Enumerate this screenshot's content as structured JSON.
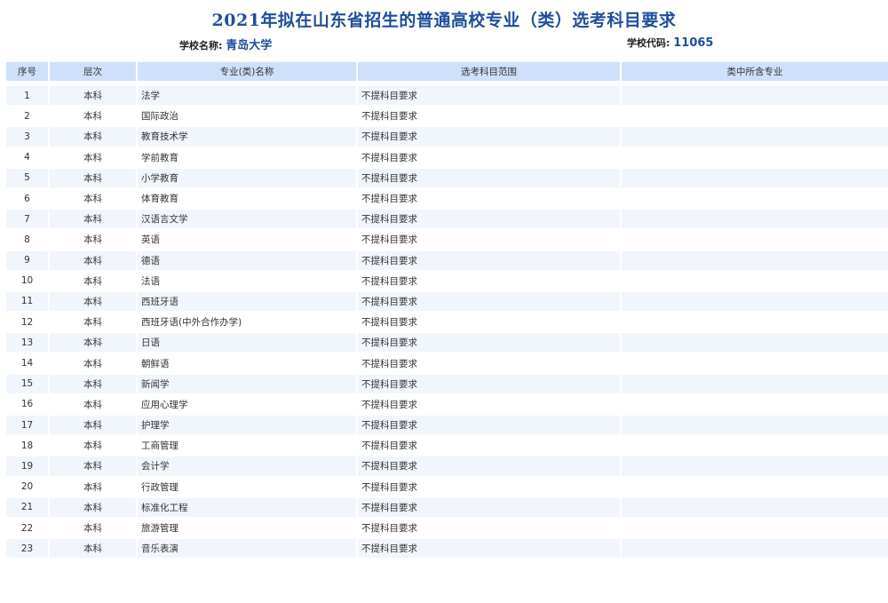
{
  "title": "2021年拟在山东省招生的普通高校专业（类）选考科目要求",
  "school": {
    "name_label": "学校名称:",
    "name": "青岛大学",
    "code_label": "学校代码:",
    "code": "11065"
  },
  "columns": [
    "序号",
    "层次",
    "专业(类)名称",
    "选考科目范围",
    "类中所含专业"
  ],
  "rows": [
    {
      "no": "1",
      "level": "本科",
      "major": "法学",
      "req": "不提科目要求",
      "sub": ""
    },
    {
      "no": "2",
      "level": "本科",
      "major": "国际政治",
      "req": "不提科目要求",
      "sub": ""
    },
    {
      "no": "3",
      "level": "本科",
      "major": "教育技术学",
      "req": "不提科目要求",
      "sub": ""
    },
    {
      "no": "4",
      "level": "本科",
      "major": "学前教育",
      "req": "不提科目要求",
      "sub": ""
    },
    {
      "no": "5",
      "level": "本科",
      "major": "小学教育",
      "req": "不提科目要求",
      "sub": ""
    },
    {
      "no": "6",
      "level": "本科",
      "major": "体育教育",
      "req": "不提科目要求",
      "sub": ""
    },
    {
      "no": "7",
      "level": "本科",
      "major": "汉语言文学",
      "req": "不提科目要求",
      "sub": ""
    },
    {
      "no": "8",
      "level": "本科",
      "major": "英语",
      "req": "不提科目要求",
      "sub": ""
    },
    {
      "no": "9",
      "level": "本科",
      "major": "德语",
      "req": "不提科目要求",
      "sub": ""
    },
    {
      "no": "10",
      "level": "本科",
      "major": "法语",
      "req": "不提科目要求",
      "sub": ""
    },
    {
      "no": "11",
      "level": "本科",
      "major": "西班牙语",
      "req": "不提科目要求",
      "sub": ""
    },
    {
      "no": "12",
      "level": "本科",
      "major": "西班牙语(中外合作办学)",
      "req": "不提科目要求",
      "sub": ""
    },
    {
      "no": "13",
      "level": "本科",
      "major": "日语",
      "req": "不提科目要求",
      "sub": ""
    },
    {
      "no": "14",
      "level": "本科",
      "major": "朝鲜语",
      "req": "不提科目要求",
      "sub": ""
    },
    {
      "no": "15",
      "level": "本科",
      "major": "新闻学",
      "req": "不提科目要求",
      "sub": ""
    },
    {
      "no": "16",
      "level": "本科",
      "major": "应用心理学",
      "req": "不提科目要求",
      "sub": ""
    },
    {
      "no": "17",
      "level": "本科",
      "major": "护理学",
      "req": "不提科目要求",
      "sub": ""
    },
    {
      "no": "18",
      "level": "本科",
      "major": "工商管理",
      "req": "不提科目要求",
      "sub": ""
    },
    {
      "no": "19",
      "level": "本科",
      "major": "会计学",
      "req": "不提科目要求",
      "sub": ""
    },
    {
      "no": "20",
      "level": "本科",
      "major": "行政管理",
      "req": "不提科目要求",
      "sub": ""
    },
    {
      "no": "21",
      "level": "本科",
      "major": "标准化工程",
      "req": "不提科目要求",
      "sub": ""
    },
    {
      "no": "22",
      "level": "本科",
      "major": "旅游管理",
      "req": "不提科目要求",
      "sub": ""
    },
    {
      "no": "23",
      "level": "本科",
      "major": "音乐表演",
      "req": "不提科目要求",
      "sub": ""
    }
  ]
}
